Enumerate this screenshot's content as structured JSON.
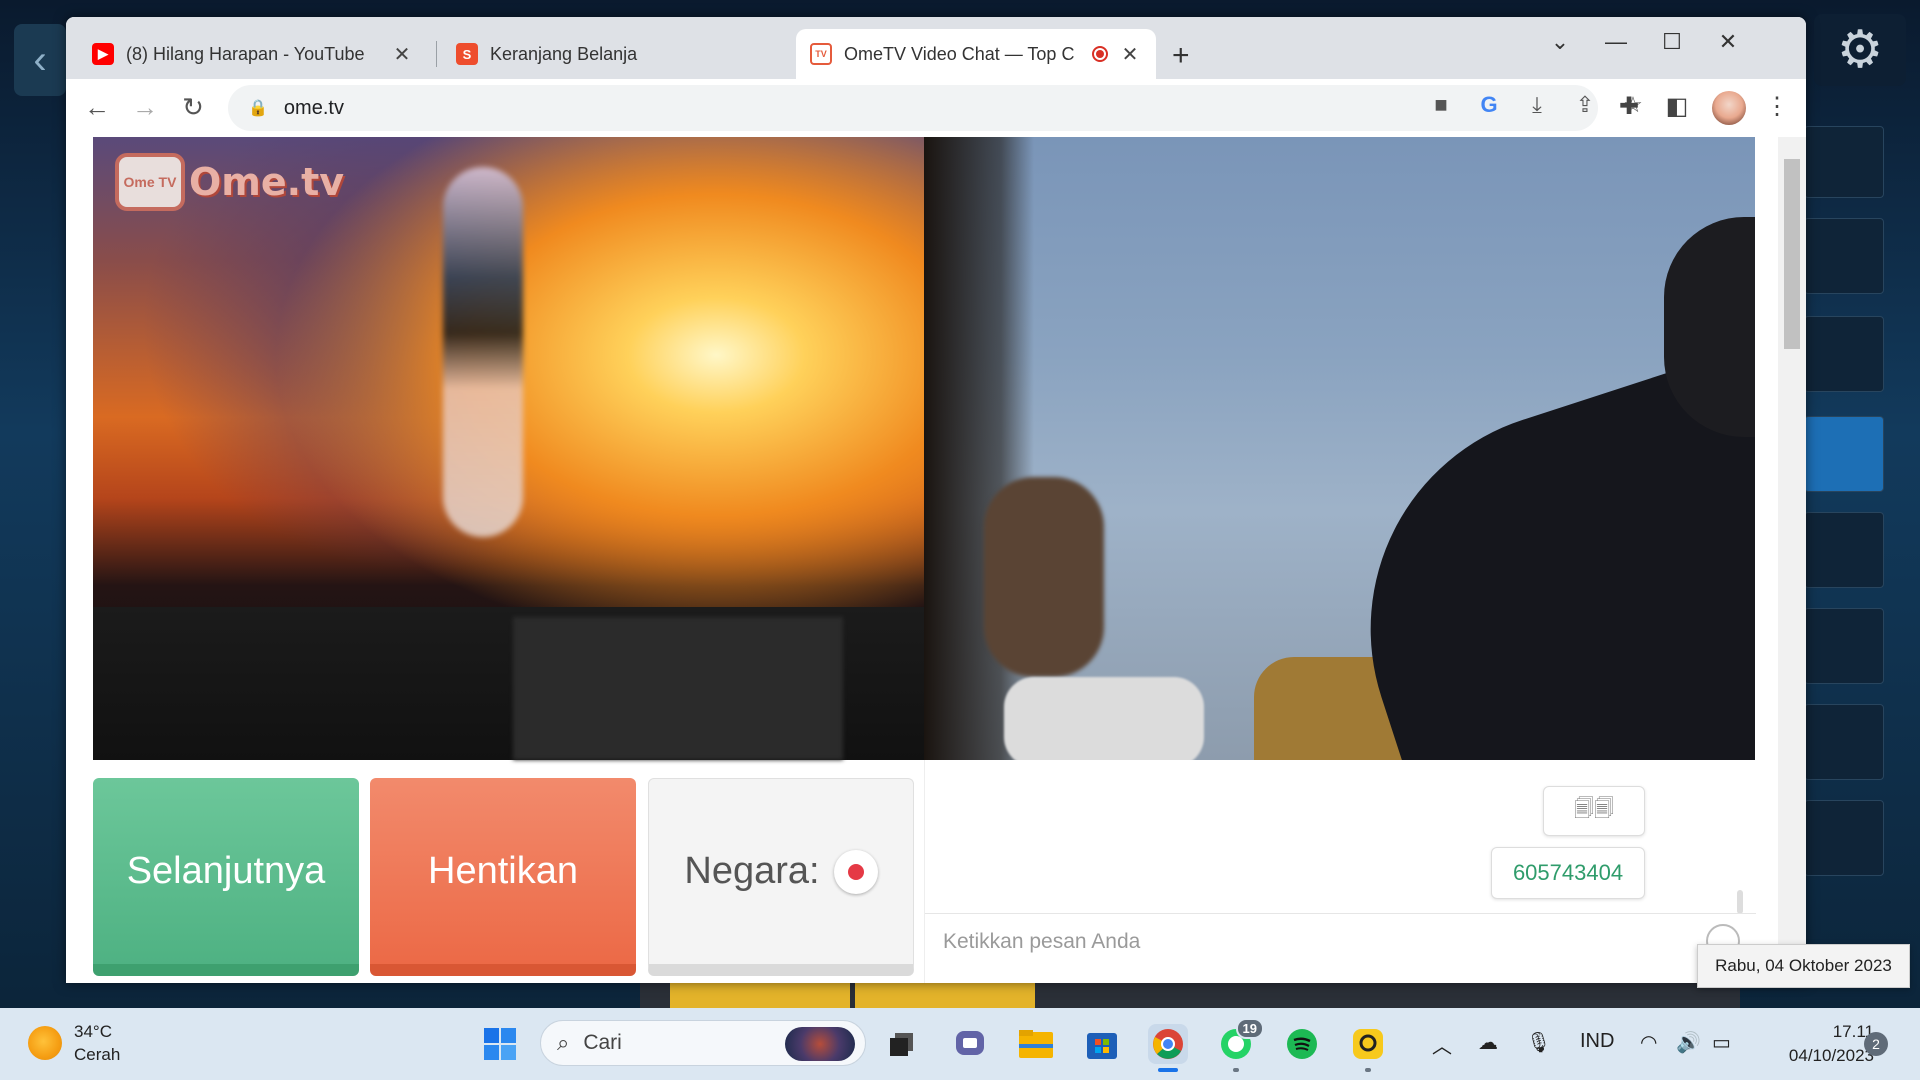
{
  "browser": {
    "tabs": [
      {
        "label": "(8) Hilang Harapan - YouTube",
        "icon": "youtube-icon"
      },
      {
        "label": "Keranjang Belanja",
        "icon": "shopee-icon"
      },
      {
        "label": "OmeTV Video Chat — Top C",
        "icon": "ometv-icon",
        "active": true
      }
    ],
    "address": "ome.tv"
  },
  "page": {
    "logo_badge": "Ome TV",
    "logo_text": "Ome.tv",
    "next_button": "Selanjutnya",
    "stop_button": "Hentikan",
    "country_label": "Negara:",
    "messages": [
      "🗐🗐",
      "605743404"
    ],
    "chat_placeholder": "Ketikkan pesan Anda",
    "date_tooltip": "Rabu, 04 Oktober 2023"
  },
  "taskbar": {
    "temperature": "34°C",
    "weather": "Cerah",
    "search_placeholder": "Cari",
    "whatsapp_badge": "19",
    "language": "IND",
    "time": "17.11",
    "date": "04/10/2023",
    "notification_count": "2"
  },
  "colors": {
    "next": "#4fb283",
    "stop": "#ec6a47",
    "accent_red": "#e53945"
  }
}
